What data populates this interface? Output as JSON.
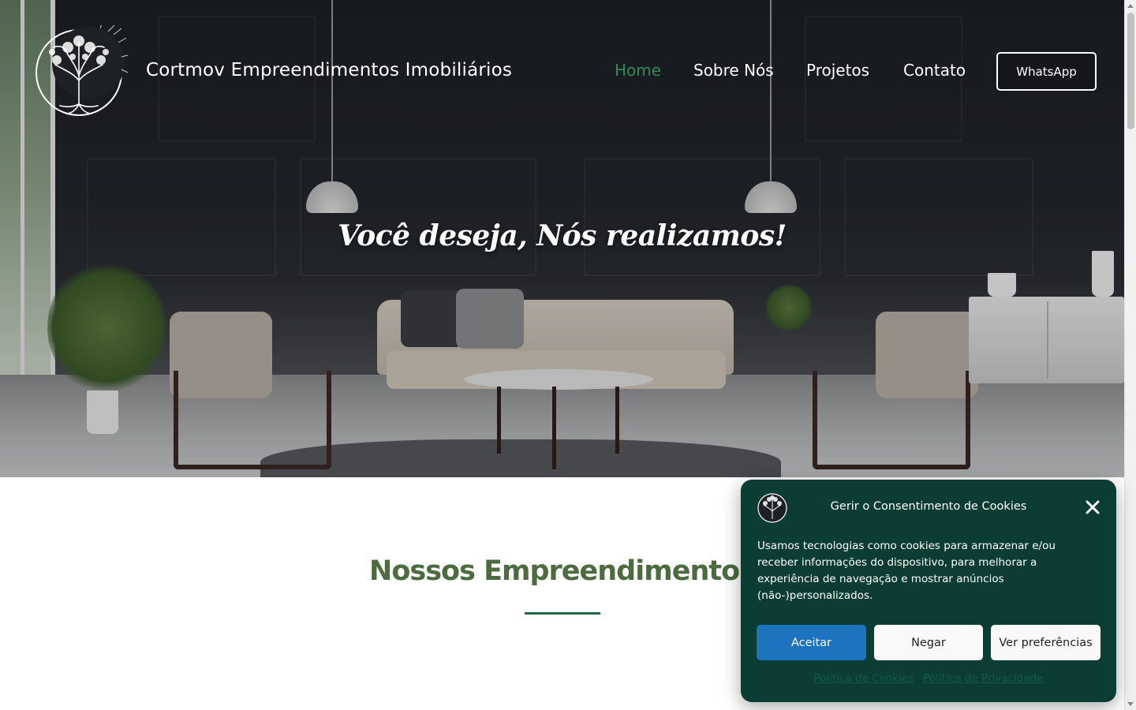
{
  "header": {
    "site_title": "Cortmov Empreendimentos Imobiliários",
    "logo_icon": "tree-of-life-logo",
    "nav": [
      {
        "label": "Home",
        "active": true
      },
      {
        "label": "Sobre Nós",
        "active": false
      },
      {
        "label": "Projetos",
        "active": false
      },
      {
        "label": "Contato",
        "active": false
      }
    ],
    "cta_label": "WhatsApp"
  },
  "hero": {
    "tagline": "Você deseja, Nós realizamos!"
  },
  "section": {
    "title": "Nossos Empreendimentos"
  },
  "cookie_banner": {
    "title": "Gerir o Consentimento de Cookies",
    "text": "Usamos tecnologias como cookies para armazenar e/ou receber informações do dispositivo, para melhorar a experiência de navegação e mostrar anúncios (não-)personalizados.",
    "accept_label": "Aceitar",
    "deny_label": "Negar",
    "prefs_label": "Ver preferências",
    "links": [
      "Política de Cookies",
      "Política de Privacidade"
    ],
    "close_icon": "close-icon"
  },
  "colors": {
    "nav_active": "#2e8c55",
    "section_title": "#4c6b3f",
    "section_rule": "#1f6a42",
    "cookie_bg": "#0c3d35",
    "accept_bg": "#1e73be"
  }
}
